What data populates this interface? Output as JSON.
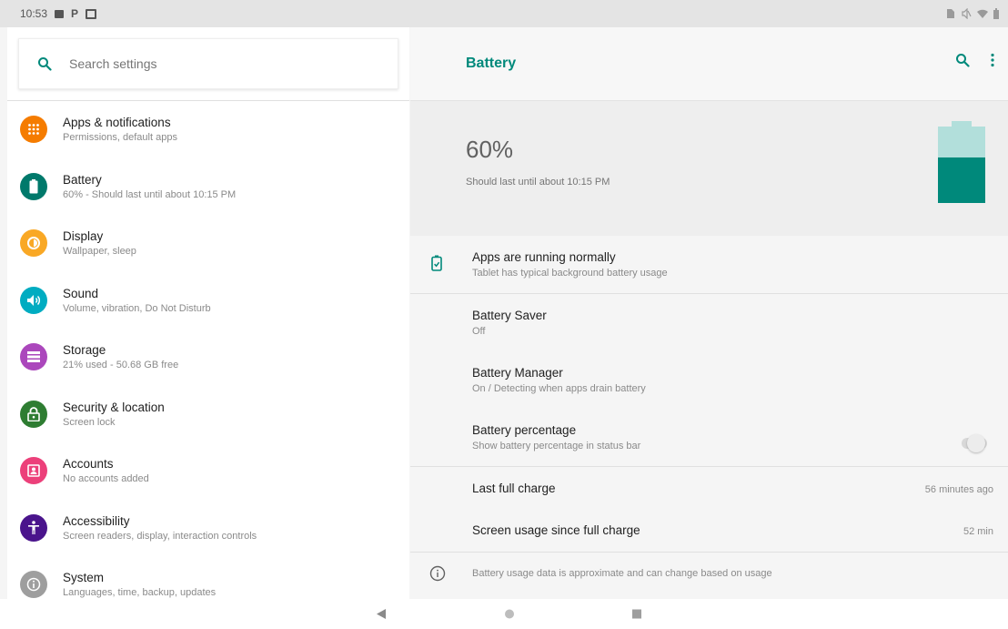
{
  "status_bar": {
    "time": "10:53",
    "left_icons": [
      "image-notification-icon",
      "p-notification-icon",
      "calendar-notification-icon"
    ],
    "right_icons": [
      "no-sim-icon",
      "mute-icon",
      "wifi-icon",
      "battery-status-icon"
    ],
    "p_glyph": "P"
  },
  "search": {
    "placeholder": "Search settings"
  },
  "settings_list": [
    {
      "title": "Apps & notifications",
      "subtitle": "Permissions, default apps",
      "icon": "apps-icon",
      "color": "#f57c00"
    },
    {
      "title": "Battery",
      "subtitle": "60% - Should last until about 10:15 PM",
      "icon": "battery-icon",
      "color": "#00796b"
    },
    {
      "title": "Display",
      "subtitle": "Wallpaper, sleep",
      "icon": "display-icon",
      "color": "#f9a825"
    },
    {
      "title": "Sound",
      "subtitle": "Volume, vibration, Do Not Disturb",
      "icon": "sound-icon",
      "color": "#00acc1"
    },
    {
      "title": "Storage",
      "subtitle": "21% used - 50.68 GB free",
      "icon": "storage-icon",
      "color": "#ab47bc"
    },
    {
      "title": "Security & location",
      "subtitle": "Screen lock",
      "icon": "lock-icon",
      "color": "#2e7d32"
    },
    {
      "title": "Accounts",
      "subtitle": "No accounts added",
      "icon": "accounts-icon",
      "color": "#ec407a"
    },
    {
      "title": "Accessibility",
      "subtitle": "Screen readers, display, interaction controls",
      "icon": "accessibility-icon",
      "color": "#4a148c"
    },
    {
      "title": "System",
      "subtitle": "Languages, time, backup, updates",
      "icon": "system-icon",
      "color": "#9e9e9e"
    }
  ],
  "detail": {
    "title": "Battery",
    "accent_color": "#00897b",
    "battery_level": "60%",
    "battery_fraction": 0.6,
    "battery_estimate": "Should last until about 10:15 PM",
    "status": {
      "title": "Apps are running normally",
      "subtitle": "Tablet has typical background battery usage"
    },
    "battery_saver": {
      "title": "Battery Saver",
      "subtitle": "Off"
    },
    "battery_manager": {
      "title": "Battery Manager",
      "subtitle": "On / Detecting when apps drain battery"
    },
    "battery_percentage": {
      "title": "Battery percentage",
      "subtitle": "Show battery percentage in status bar",
      "enabled": false
    },
    "last_full_charge": {
      "title": "Last full charge",
      "value": "56 minutes ago"
    },
    "screen_usage": {
      "title": "Screen usage since full charge",
      "value": "52 min"
    },
    "footer": "Battery usage data is approximate and can change based on usage"
  },
  "nav": {
    "buttons": [
      "back-icon",
      "home-icon",
      "recents-icon"
    ]
  }
}
